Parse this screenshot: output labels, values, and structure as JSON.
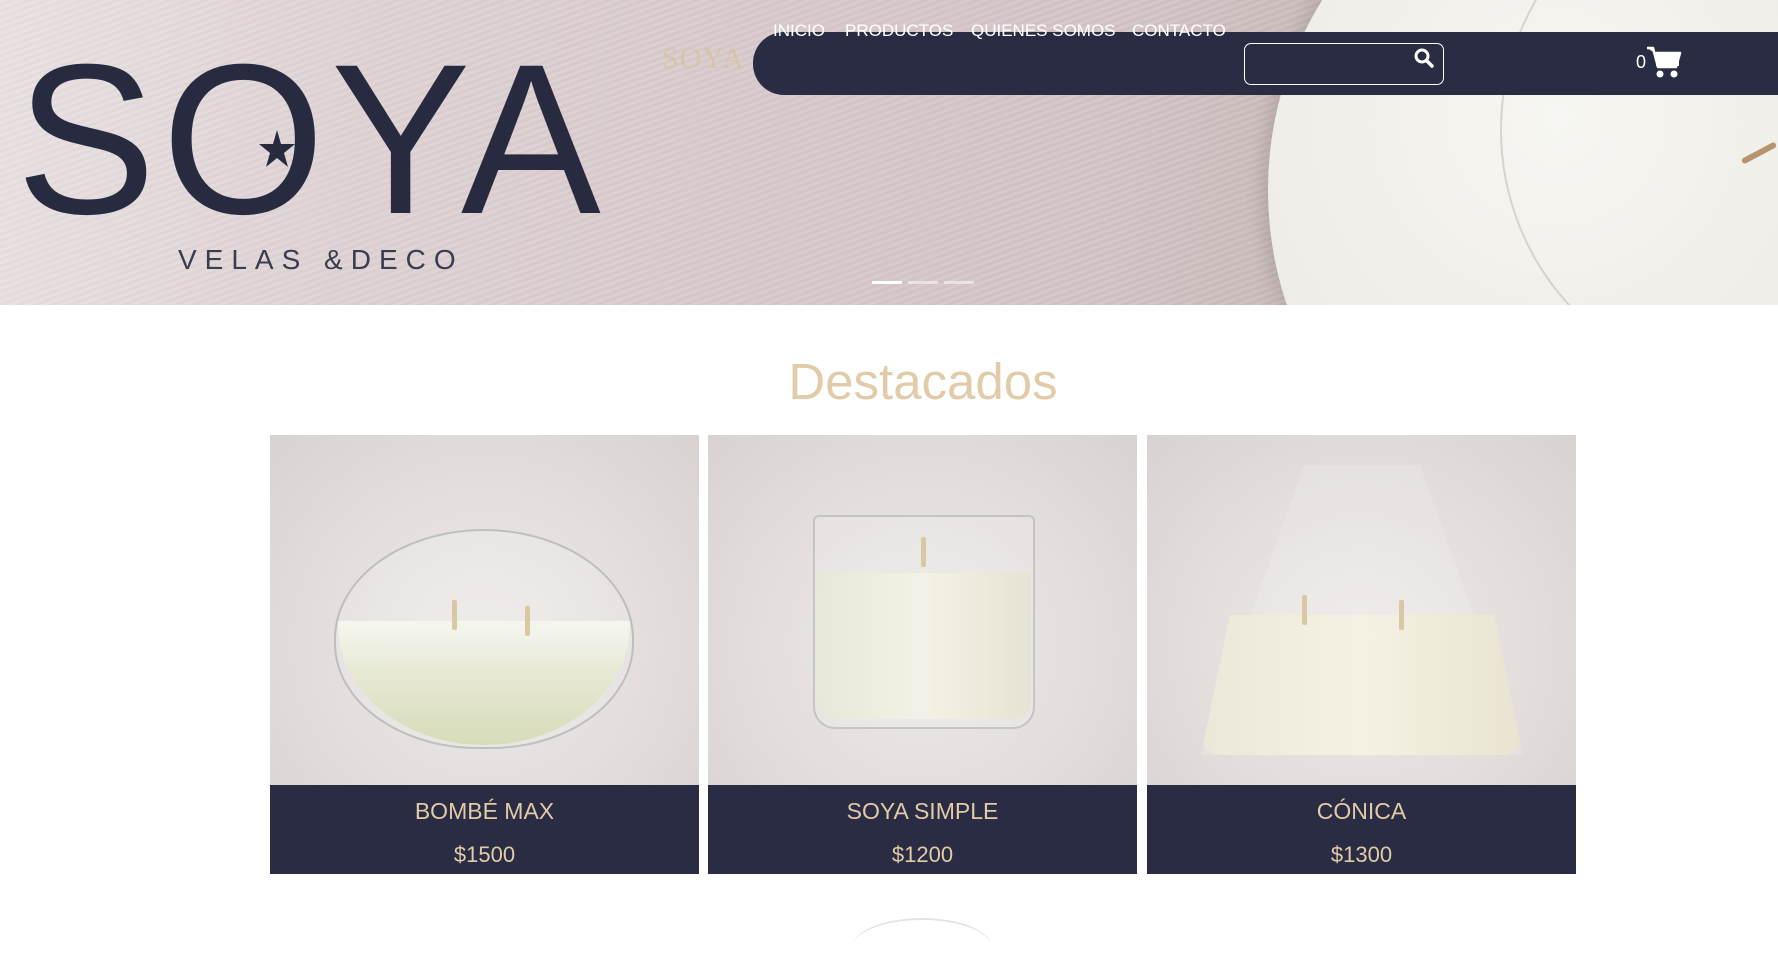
{
  "brand": {
    "logo_word": "SOYA",
    "logo_subtitle": "VELAS &DECO",
    "ghost_text": "SOYA"
  },
  "nav": {
    "links": [
      "INICIO",
      "PRODUCTOS",
      "QUIENES SOMOS",
      "CONTACTO"
    ],
    "search_placeholder": "",
    "search_icon": "search-icon",
    "cart_count": "0",
    "cart_icon": "cart-icon"
  },
  "carousel": {
    "active_index": 0,
    "count": 3
  },
  "featured": {
    "title": "Destacados",
    "products": [
      {
        "name": "BOMBÉ MAX",
        "price": "$1500"
      },
      {
        "name": "SOYA SIMPLE",
        "price": "$1200"
      },
      {
        "name": "CÓNICA",
        "price": "$1300"
      }
    ]
  },
  "colors": {
    "navy": "#292c42",
    "accent_beige": "#e2cba8",
    "white": "#ffffff"
  }
}
